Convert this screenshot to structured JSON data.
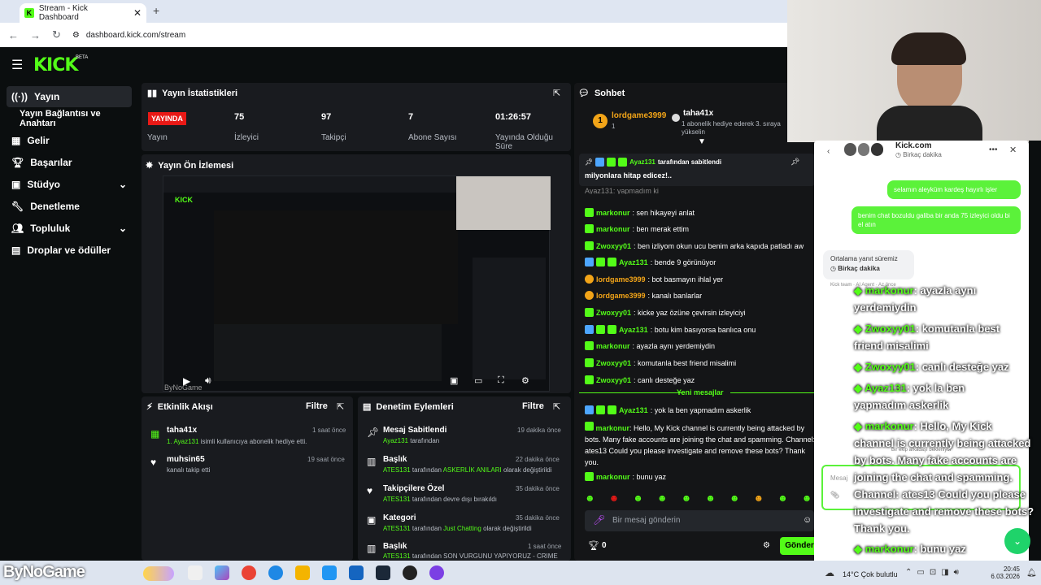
{
  "browser": {
    "tab_title": "Stream - Kick Dashboard",
    "url": "dashboard.kick.com/stream"
  },
  "brand": {
    "logo": "KICK",
    "beta": "BETA"
  },
  "sidebar": {
    "items": [
      {
        "label": "Yayın",
        "icon": "broadcast-icon"
      },
      {
        "label": "Yayın Bağlantısı ve Anahtarı",
        "icon": ""
      },
      {
        "label": "Gelir",
        "icon": "dollar-icon"
      },
      {
        "label": "Başarılar",
        "icon": "trophy-icon"
      },
      {
        "label": "Stüdyo",
        "icon": "grid-icon"
      },
      {
        "label": "Denetleme",
        "icon": "wrench-icon"
      },
      {
        "label": "Topluluk",
        "icon": "people-icon"
      },
      {
        "label": "Droplar ve ödüller",
        "icon": "gift-icon"
      }
    ]
  },
  "stats": {
    "title": "Yayın İstatistikleri",
    "status_badge": "YAYINDA",
    "status_label": "Yayın",
    "viewers": {
      "value": "75",
      "label": "İzleyici"
    },
    "followers": {
      "value": "97",
      "label": "Takipçi"
    },
    "subs": {
      "value": "7",
      "label": "Abone Sayısı"
    },
    "uptime": {
      "value": "01:26:57",
      "label1": "Yayında Olduğu",
      "label2": "Süre"
    }
  },
  "preview": {
    "title": "Yayın Ön İzlemesi",
    "watermark": "ByNoGame"
  },
  "activity": {
    "title": "Etkinlik Akışı",
    "filter": "Filtre",
    "items": [
      {
        "user": "taha41x",
        "detail_user": "1. Ayaz131",
        "detail": " isimli kullanıcıya abonelik hediye etti.",
        "time": "1 saat önce"
      },
      {
        "user": "muhsin65",
        "detail_user": "",
        "detail": "kanalı takip etti",
        "time": "19 saat önce"
      }
    ]
  },
  "moderation": {
    "title": "Denetim Eylemleri",
    "filter": "Filtre",
    "items": [
      {
        "title": "Mesaj Sabitlendi",
        "time": "19 dakika önce",
        "who": "Ayaz131",
        "rest": " tarafından"
      },
      {
        "title": "Başlık",
        "time": "22 dakika önce",
        "who": "ATES131",
        "rest": " tarafından ",
        "val": "ASKERLİK ANILARI",
        "rest2": " olarak değiştirildi"
      },
      {
        "title": "Takipçilere Özel",
        "time": "35 dakika önce",
        "who": "ATES131",
        "rest": " tarafından devre dışı bırakıldı"
      },
      {
        "title": "Kategori",
        "time": "35 dakika önce",
        "who": "ATES131",
        "rest": " tarafından ",
        "val": "Just Chatting",
        "rest2": " olarak değiştirildi"
      },
      {
        "title": "Başlık",
        "time": "1 saat önce",
        "who": "ATES131",
        "rest": " tarafından ",
        "val": "SON VURGUNU YAPIYORUZ - CRIME",
        "rest2": ""
      }
    ]
  },
  "chat": {
    "title": "Sohbet",
    "top1": {
      "user": "lordgame3999",
      "sub": "1"
    },
    "top2": {
      "user": "taha41x",
      "line1": "1 abonelik hediye ederek 3. sıraya",
      "line2": "yükselin"
    },
    "pinned": {
      "by": "Ayaz131",
      "by_rest": " tarafından sabitlendi",
      "text": "milyonlara hitap edicez!.."
    },
    "partial": "Ayaz131: yapmadım ki",
    "messages": [
      {
        "user": "markonur",
        "text": ": sen hikayeyi anlat",
        "badge": "g"
      },
      {
        "user": "markonur",
        "text": ": ben merak ettim",
        "badge": "g"
      },
      {
        "user": "Zwoxyy01",
        "text": ": ben izliyom okun ucu benim arka kapıda patladı aw",
        "badge": "g"
      },
      {
        "user": "Ayaz131",
        "text": ": bende 9 görünüyor",
        "badge": "b"
      },
      {
        "user": "lordgame3999",
        "text": ": bot basmayın ihlal yer",
        "badge": "o"
      },
      {
        "user": "lordgame3999",
        "text": ": kanalı banlarlar",
        "badge": "o"
      },
      {
        "user": "Zwoxyy01",
        "text": ": kicke yaz özüne çevirsin izleyiciyi",
        "badge": "g"
      },
      {
        "user": "Ayaz131",
        "text": ": botu kim basıyorsa banlıca onu",
        "badge": "b"
      },
      {
        "user": "markonur",
        "text": ": ayazla aynı yerdemiydin",
        "badge": "g"
      },
      {
        "user": "Zwoxyy01",
        "text": ": komutanla best friend misalimi",
        "badge": "g"
      },
      {
        "user": "Zwoxyy01",
        "text": ": canlı desteğe yaz",
        "badge": "g"
      }
    ],
    "new_messages": "Yeni mesajlar",
    "after": [
      {
        "user": "Ayaz131",
        "text": ": yok la ben yapmadım askerlik",
        "badge": "b"
      }
    ],
    "long": {
      "user": "markonur",
      "lines": [
        ": Hello, My Kick channel is currently being attacked by",
        "bots. Many fake accounts are joining the chat and spamming.",
        "Channel: ates13 Could you please investigate and remove these bots?",
        "Thank you."
      ]
    },
    "last": {
      "user": "markonur",
      "text": ": bunu yaz"
    },
    "input_placeholder": "Bir mesaj gönderin",
    "count": "0",
    "send": "Gönder"
  },
  "support": {
    "title": "Kick.com",
    "subtitle": "Birkaç dakika",
    "msg1": "selamın aleyküm kardeş hayırlı işler",
    "msg2": "benim chat bozuldu galiba bir anda 75 izleyici oldu bi el atın",
    "reply_title": "Ortalama yanıt süremiz",
    "reply_time": "Birkaç dakika",
    "footer": "Kick team · AI Agent · Az önce",
    "typing": "Bir ekip arkadaşı bekleniyor",
    "input_placeholder": "Mesaj"
  },
  "overlay": [
    {
      "user": "markonur",
      "text": ": ayazla aynı"
    },
    {
      "user": "",
      "text": "yerdemiydin"
    },
    {
      "user": "Zwoxyy01",
      "text": ": komutanla best"
    },
    {
      "user": "",
      "text": "friend misalimi"
    },
    {
      "user": "Zwoxyy01",
      "text": ": canlı desteğe yaz"
    },
    {
      "user": "Ayaz131",
      "text": ": yok la ben"
    },
    {
      "user": "",
      "text": "yapmadım askerlik"
    },
    {
      "user": "markonur",
      "text": ": Hello, My Kick"
    },
    {
      "user": "",
      "text": "channel is currently being attacked"
    },
    {
      "user": "",
      "text": "by bots. Many fake accounts are"
    },
    {
      "user": "",
      "text": "joining the chat and spamming."
    },
    {
      "user": "",
      "text": "Channel: ates13 Could you please"
    },
    {
      "user": "",
      "text": "investigate and remove these bots?"
    },
    {
      "user": "",
      "text": "Thank you."
    },
    {
      "user": "markonur",
      "text": ": bunu yaz"
    }
  ],
  "taskbar": {
    "watermark": "ByNoGame",
    "weather": "14°C  Çok bulutlu",
    "time": "20:45",
    "date": "6.03.2026"
  }
}
